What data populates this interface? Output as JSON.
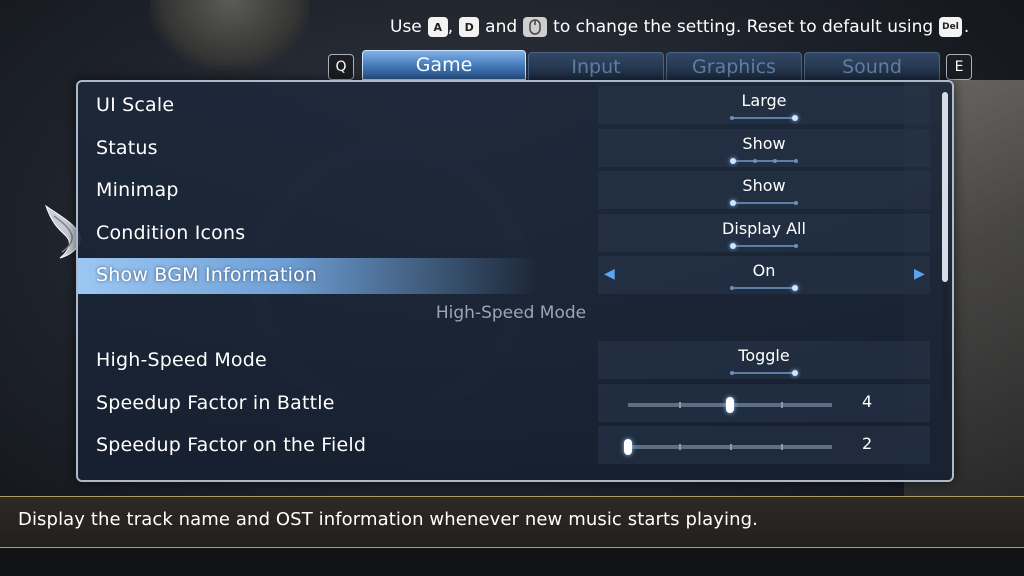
{
  "hint": {
    "use": "Use",
    "key_a": "A",
    "comma": ",",
    "key_d": "D",
    "and": "and",
    "mouse_icon": "mouse-icon",
    "to_change": "to change the setting. Reset to default using",
    "key_del": "Del",
    "end": "."
  },
  "tabs": {
    "prev_key": "Q",
    "next_key": "E",
    "items": [
      {
        "label": "Game",
        "active": true
      },
      {
        "label": "Input",
        "active": false
      },
      {
        "label": "Graphics",
        "active": false
      },
      {
        "label": "Sound",
        "active": false
      }
    ]
  },
  "settings": [
    {
      "label": "UI Scale",
      "value": "Large",
      "options": 2,
      "selected": 2
    },
    {
      "label": "Status",
      "value": "Show",
      "options": 4,
      "selected": 1
    },
    {
      "label": "Minimap",
      "value": "Show",
      "options": 2,
      "selected": 1
    },
    {
      "label": "Condition Icons",
      "value": "Display All",
      "options": 2,
      "selected": 1
    },
    {
      "label": "Show BGM Information",
      "value": "On",
      "options": 2,
      "selected": 2
    }
  ],
  "section_title": "High-Speed Mode",
  "speed": {
    "mode_label": "High-Speed Mode",
    "mode_value": "Toggle",
    "mode_options": 2,
    "mode_selected": 2,
    "battle_label": "Speedup Factor in Battle",
    "battle_value": "4",
    "field_label": "Speedup Factor on the Field",
    "field_value": "2"
  },
  "slider_range": {
    "min": 2,
    "max": 6
  },
  "description": "Display the track name and OST information whenever new music starts playing.",
  "colors": {
    "accent": "#6e9fd5",
    "panel_border": "#aeb9c8",
    "desc_border": "#b29a63"
  }
}
